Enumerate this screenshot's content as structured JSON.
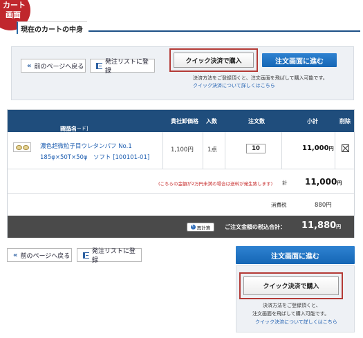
{
  "badge": {
    "line1": "カート",
    "line2": "画面"
  },
  "section_title": "現在のカートの中身",
  "top": {
    "back_label": "前のページへ戻る",
    "list_label": "発注リストに登録",
    "quick_label": "クイック決済で購入",
    "order_label": "注文画面に進む",
    "note1": "決済方法をご登録頂くと、注文画面を飛ばして購入可能です。",
    "note_link": "クイック決済について詳しくはこちら"
  },
  "table": {
    "headers": {
      "name": "商品名",
      "code": "[発注コード]",
      "price": "貴社卸価格",
      "unit": "入数",
      "qty": "注文数",
      "subtotal": "小計",
      "delete": "削除"
    },
    "item": {
      "name_line1": "濃色超微粒子目ウレタンパフ No.1",
      "name_line2": "185φ×50T×50φ　ソフト [100101-01]",
      "price": "1,100円",
      "unit": "1点",
      "qty": "10",
      "subtotal": "11,000",
      "subtotal_yen": "円"
    },
    "shipping_note": "(こちらの金額が2万円未満の場合は送料が発生致します)",
    "total_label": "計",
    "total_value": "11,000",
    "total_yen": "円",
    "tax_label": "消費税",
    "tax_value": "880円",
    "recalc_label": "再計算",
    "grand_label": "ご注文金額の税込合計：",
    "grand_value": "11,880",
    "grand_yen": "円"
  },
  "bottom": {
    "back_label": "前のページへ戻る",
    "list_label": "発注リストに登録",
    "order_label": "注文画面に進む",
    "quick_label": "クイック決済で購入",
    "note1": "決済方法をご登録頂くと、",
    "note2": "注文画面を飛ばして購入可能です。",
    "note_link": "クイック決済について詳しくはこちら"
  },
  "colors": {
    "accent_blue": "#1f4d7c",
    "order_button": "#1e6fc0",
    "highlight_red": "#b43a36",
    "badge_red": "#c0272d"
  }
}
